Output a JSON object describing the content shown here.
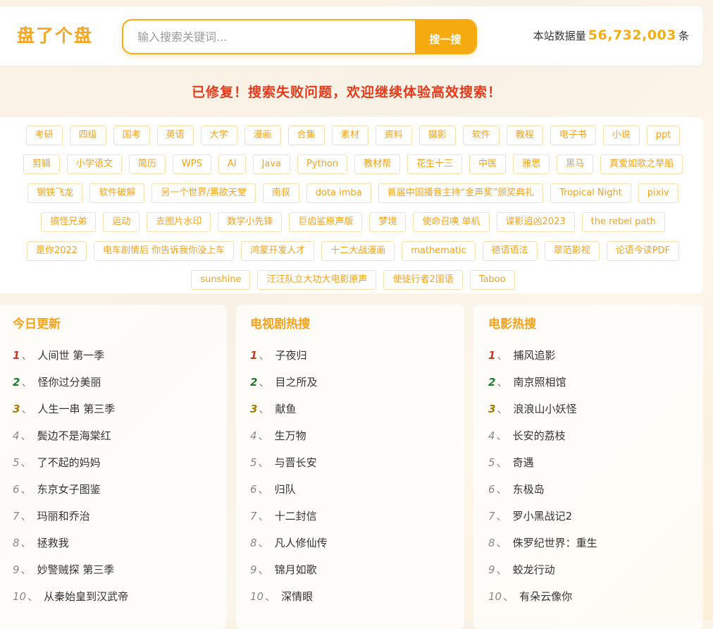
{
  "header": {
    "logo": "盘了个盘",
    "search_placeholder": "输入搜索关键词...",
    "search_button": "搜一搜",
    "stats_prefix": "本站数据量",
    "stats_count": "56,732,003",
    "stats_suffix": "条"
  },
  "notice": "已修复！搜索失败问题，欢迎继续体验高效搜索！",
  "tags": [
    "考研",
    "四级",
    "国考",
    "英语",
    "大学",
    "漫画",
    "合集",
    "素材",
    "资料",
    "摄影",
    "软件",
    "教程",
    "电子书",
    "小说",
    "ppt",
    "剪辑",
    "小学语文",
    "简历",
    "WPS",
    "AI",
    "Java",
    "Python",
    "教材帮",
    "花生十三",
    "中医",
    "雅思",
    "黑马",
    "真爱如歌之旱船",
    "钢铁飞龙",
    "软件破解",
    "另一个世界/黑欲天堂",
    "南叔",
    "dota imba",
    "首届中国播音主持“金声奖”颁奖典礼",
    "Tropical Night",
    "pixiv",
    "搞怪兄弟",
    "运动",
    "去图片水印",
    "数学小先锋",
    "巨齿鲨原声版",
    "梦境",
    "使命召唤 单机",
    "谍影追凶2023",
    "the rebel path",
    "是你2022",
    "电车剧情后 你告诉我你没上车",
    "鸿蒙开发人才",
    "十二大战漫画",
    "mathematic",
    "德语语法",
    "翠范影视",
    "论语今读PDF",
    "sunshine",
    "汪汪队立大功大电影原声",
    "使徒行者2国语",
    "Taboo"
  ],
  "columns": [
    {
      "title": "今日更新",
      "items": [
        {
          "rank": "1",
          "name": "人间世 第一季"
        },
        {
          "rank": "2",
          "name": "怪你过分美丽"
        },
        {
          "rank": "3",
          "name": "人生一串 第三季"
        },
        {
          "rank": "4",
          "name": "鬓边不是海棠红"
        },
        {
          "rank": "5",
          "name": "了不起的妈妈"
        },
        {
          "rank": "6",
          "name": "东京女子图鉴"
        },
        {
          "rank": "7",
          "name": "玛丽和乔治"
        },
        {
          "rank": "8",
          "name": "拯救我"
        },
        {
          "rank": "9",
          "name": "妙警贼探 第三季"
        },
        {
          "rank": "10",
          "name": "从秦始皇到汉武帝"
        }
      ]
    },
    {
      "title": "电视剧热搜",
      "items": [
        {
          "rank": "1",
          "name": "子夜归"
        },
        {
          "rank": "2",
          "name": "目之所及"
        },
        {
          "rank": "3",
          "name": "献鱼"
        },
        {
          "rank": "4",
          "name": "生万物"
        },
        {
          "rank": "5",
          "name": "与晋长安"
        },
        {
          "rank": "6",
          "name": "归队"
        },
        {
          "rank": "7",
          "name": "十二封信"
        },
        {
          "rank": "8",
          "name": "凡人修仙传"
        },
        {
          "rank": "9",
          "name": "锦月如歌"
        },
        {
          "rank": "10",
          "name": "深情眼"
        }
      ]
    },
    {
      "title": "电影热搜",
      "items": [
        {
          "rank": "1",
          "name": "捕风追影"
        },
        {
          "rank": "2",
          "name": "南京照相馆"
        },
        {
          "rank": "3",
          "name": "浪浪山小妖怪"
        },
        {
          "rank": "4",
          "name": "长安的荔枝"
        },
        {
          "rank": "5",
          "name": "奇遇"
        },
        {
          "rank": "6",
          "name": "东极岛"
        },
        {
          "rank": "7",
          "name": "罗小黑战记2"
        },
        {
          "rank": "8",
          "name": "侏罗纪世界：重生"
        },
        {
          "rank": "9",
          "name": "蛟龙行动"
        },
        {
          "rank": "10",
          "name": "有朵云像你"
        }
      ]
    }
  ],
  "rank_separator": "、",
  "colors": {
    "accent": "#f5ad17",
    "notice": "#e5391a",
    "rank1": "#c0392b",
    "rank2": "#1e7a2e",
    "rank3": "#a57c00"
  }
}
